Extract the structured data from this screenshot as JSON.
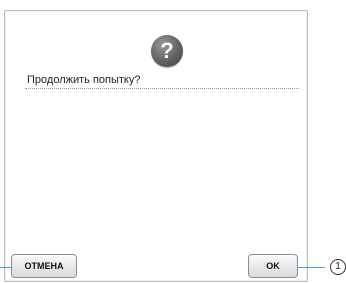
{
  "dialog": {
    "icon": "question-icon",
    "icon_glyph": "?",
    "message": "Продолжить попытку?",
    "cancel_label": "ОТМЕНА",
    "ok_label": "OK"
  },
  "callout": {
    "number": "1"
  },
  "colors": {
    "icon": "#5a5a5a",
    "leader_line": "#3aa0d8",
    "frame_border": "#bdbdbd"
  }
}
